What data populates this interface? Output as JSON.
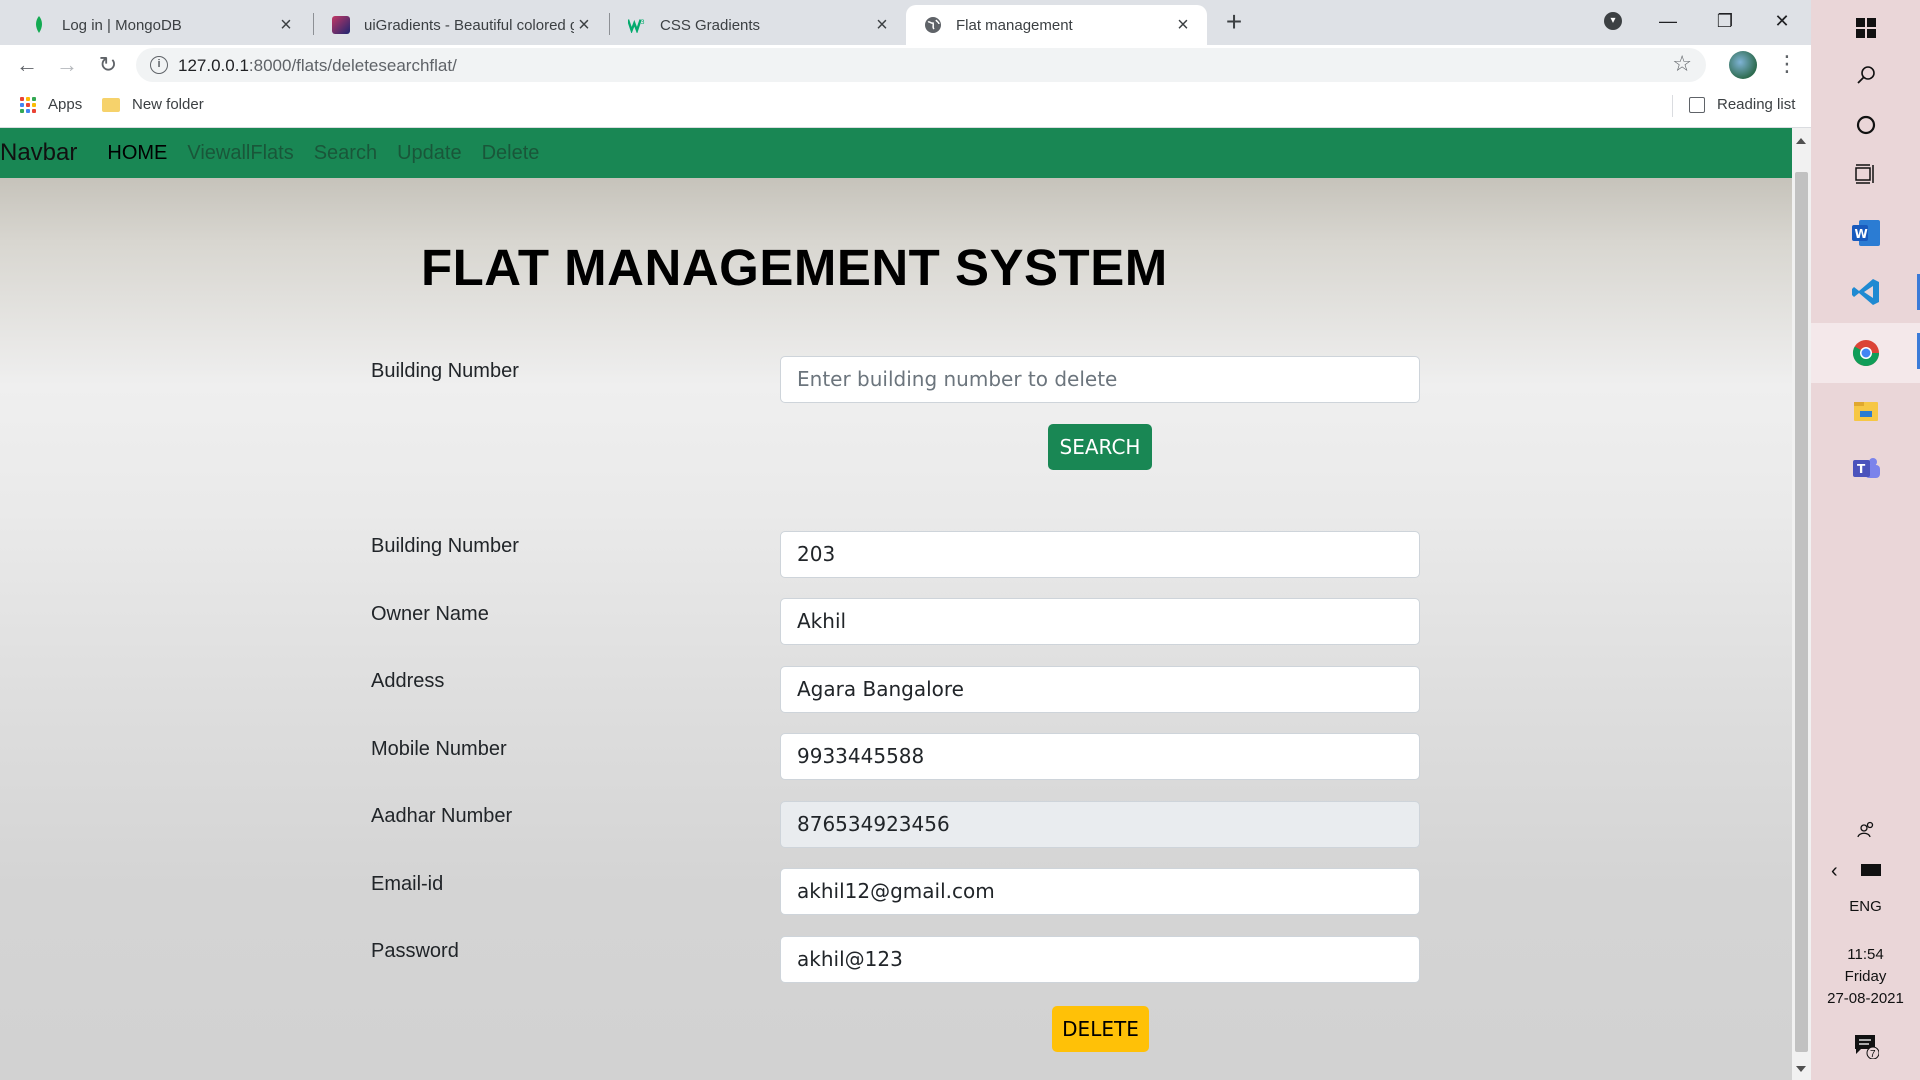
{
  "browser": {
    "tabs": [
      {
        "title": "Log in | MongoDB",
        "icon": "mongodb-leaf-icon",
        "active": false
      },
      {
        "title": "uiGradients - Beautiful colored gr",
        "icon": "uigradients-icon",
        "active": false
      },
      {
        "title": "CSS Gradients",
        "icon": "w3schools-icon",
        "active": false
      },
      {
        "title": "Flat management",
        "icon": "globe-icon",
        "active": true
      }
    ],
    "url_host": "127.0.0.1",
    "url_path": ":8000/flats/deletesearchflat/",
    "bookmarks": {
      "apps_label": "Apps",
      "folder_label": "New folder",
      "reading_list_label": "Reading list"
    }
  },
  "navbar": {
    "brand": "Navbar",
    "links": [
      "HOME",
      "ViewallFlats",
      "Search",
      "Update",
      "Delete"
    ]
  },
  "page": {
    "title": "FLAT MANAGEMENT SYSTEM",
    "search": {
      "label": "Building Number",
      "placeholder": "Enter building number to delete",
      "button": "SEARCH"
    },
    "fields": [
      {
        "label": "Building Number",
        "value": "203",
        "readonly": false
      },
      {
        "label": "Owner Name",
        "value": "Akhil",
        "readonly": false
      },
      {
        "label": "Address",
        "value": "Agara Bangalore",
        "readonly": false
      },
      {
        "label": "Mobile Number",
        "value": "9933445588",
        "readonly": false
      },
      {
        "label": "Aadhar Number",
        "value": "876534923456",
        "readonly": true
      },
      {
        "label": "Email-id",
        "value": "akhil12@gmail.com",
        "readonly": false
      },
      {
        "label": "Password",
        "value": "akhil@123",
        "readonly": false
      }
    ],
    "delete_button": "DELETE"
  },
  "taskbar": {
    "language": "ENG",
    "time": "11:54",
    "day": "Friday",
    "date": "27-08-2021",
    "notification_count": "7"
  },
  "colors": {
    "navbar": "#198754",
    "search_button": "#198754",
    "delete_button": "#ffc107"
  }
}
